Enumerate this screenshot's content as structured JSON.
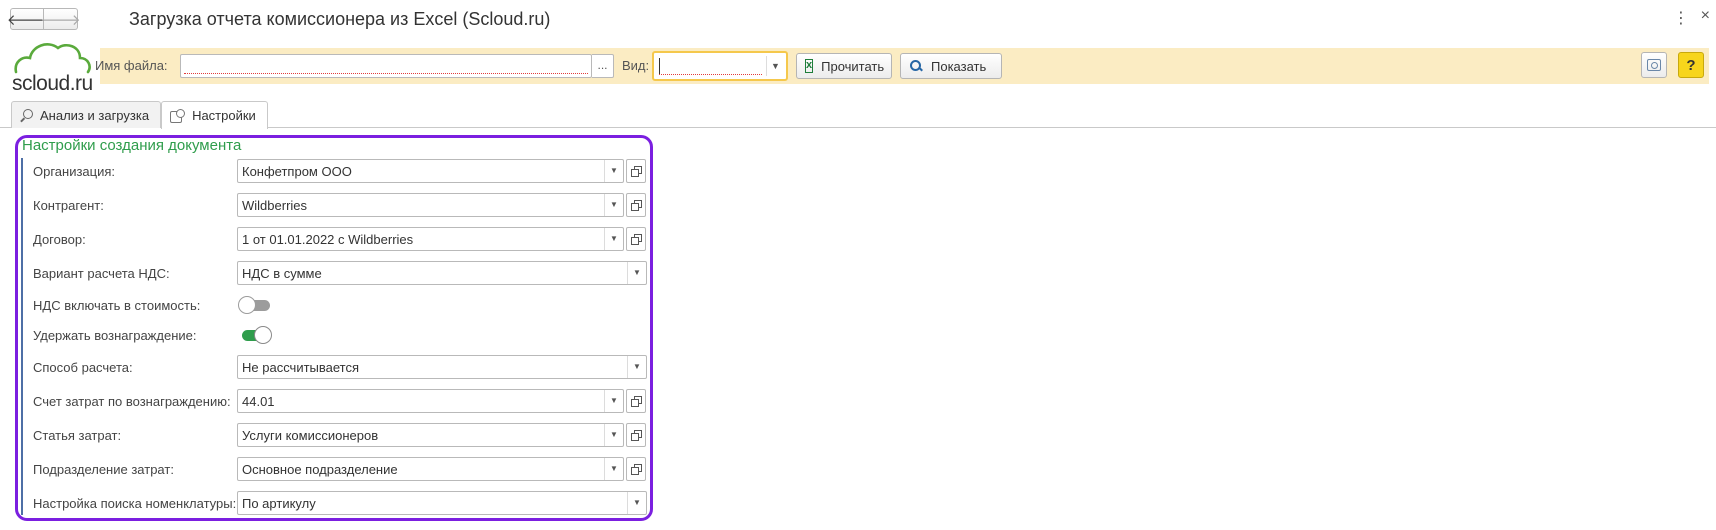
{
  "window": {
    "title": "Загрузка отчета комиссионера из Excel (Scloud.ru)",
    "back_glyph": "🡐",
    "forward_glyph": "🡒",
    "more_glyph": "⋮",
    "close_glyph": "×"
  },
  "logo": {
    "text": "scloud.ru",
    "accent_color": "#5aaa3c"
  },
  "toolbar": {
    "file_label": "Имя файла:",
    "file_value": "",
    "browse_label": "...",
    "vid_label": "Вид:",
    "vid_value": "",
    "read_button": "Прочитать",
    "show_button": "Показать",
    "help_label": "?",
    "background_color": "#fbecc3"
  },
  "tabs": [
    {
      "label": "Анализ и загрузка",
      "icon": "search-icon",
      "active": false
    },
    {
      "label": "Настройки",
      "icon": "settings-icon",
      "active": true
    }
  ],
  "settings": {
    "group_title": "Настройки создания документа",
    "title_color": "#2f9d4c",
    "rows": [
      {
        "label": "Организация:",
        "value": "Конфетпром ООО",
        "type": "select-open"
      },
      {
        "label": "Контрагент:",
        "value": "Wildberries",
        "type": "select-open"
      },
      {
        "label": "Договор:",
        "value": "1 от 01.01.2022 с Wildberries",
        "type": "select-open"
      },
      {
        "label": "Вариант расчета НДС:",
        "value": "НДС в сумме",
        "type": "select"
      },
      {
        "label": "НДС включать в стоимость:",
        "value": false,
        "type": "toggle"
      },
      {
        "label": "Удержать вознаграждение:",
        "value": true,
        "type": "toggle"
      },
      {
        "label": "Способ расчета:",
        "value": "Не рассчитывается",
        "type": "select"
      },
      {
        "label": "Счет затрат по вознаграждению:",
        "value": "44.01",
        "type": "select-open"
      },
      {
        "label": "Статья затрат:",
        "value": "Услуги комиссионеров",
        "type": "select-open"
      },
      {
        "label": "Подразделение затрат:",
        "value": "Основное подразделение",
        "type": "select-open"
      },
      {
        "label": "Настройка поиска номенклатуры:",
        "value": "По артикулу",
        "type": "select"
      }
    ]
  }
}
